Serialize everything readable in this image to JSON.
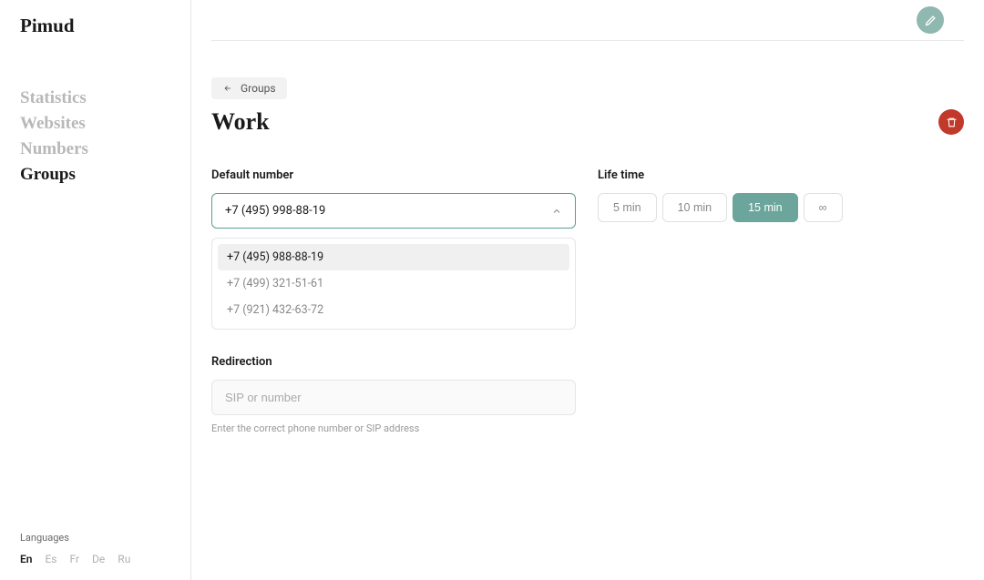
{
  "brand": "Pimud",
  "nav": {
    "items": [
      {
        "label": "Statistics",
        "active": false
      },
      {
        "label": "Websites",
        "active": false
      },
      {
        "label": "Numbers",
        "active": false
      },
      {
        "label": "Groups",
        "active": true
      }
    ]
  },
  "languages": {
    "label": "Languages",
    "items": [
      {
        "code": "En",
        "active": true
      },
      {
        "code": "Es",
        "active": false
      },
      {
        "code": "Fr",
        "active": false
      },
      {
        "code": "De",
        "active": false
      },
      {
        "code": "Ru",
        "active": false
      }
    ]
  },
  "breadcrumb": {
    "label": "Groups"
  },
  "page": {
    "title": "Work"
  },
  "default_number": {
    "label": "Default number",
    "value": "+7 (495) 998-88-19",
    "options": [
      "+7 (495) 988-88-19",
      "+7 (499) 321-51-61",
      "+7 (921) 432-63-72"
    ]
  },
  "redirection": {
    "label": "Redirection",
    "placeholder": "SIP or number",
    "hint": "Enter the correct phone number or SIP address"
  },
  "lifetime": {
    "label": "Life time",
    "options": [
      "5 min",
      "10 min",
      "15 min",
      "∞"
    ],
    "selected_index": 2
  }
}
